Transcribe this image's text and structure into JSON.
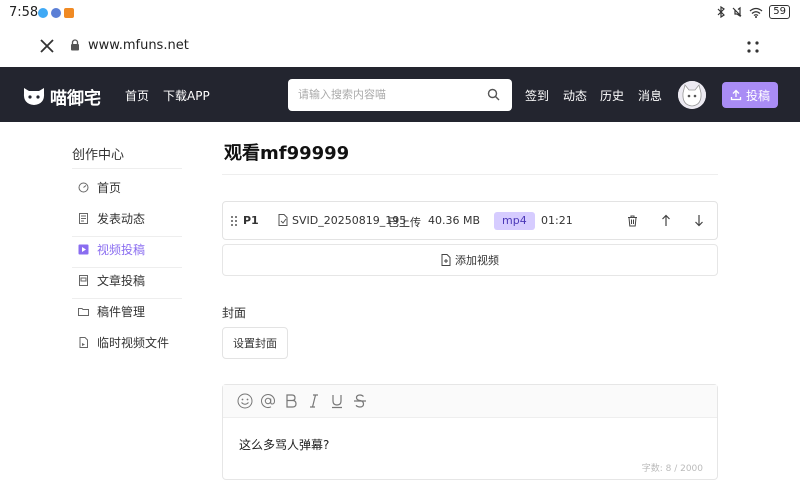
{
  "status_bar": {
    "time": "7:58",
    "battery": "59"
  },
  "browser": {
    "url": "www.mfuns.net"
  },
  "site_nav": {
    "logo_text": "喵御宅",
    "links": [
      {
        "label": "首页"
      },
      {
        "label": "下载APP"
      }
    ],
    "search_placeholder": "请输入搜索内容喵",
    "right_links": [
      {
        "label": "签到"
      },
      {
        "label": "动态"
      },
      {
        "label": "历史"
      },
      {
        "label": "消息"
      }
    ],
    "upload_label": "投稿"
  },
  "sidebar": {
    "title": "创作中心",
    "items": [
      {
        "label": "首页",
        "icon": "dashboard-icon"
      },
      {
        "label": "发表动态",
        "icon": "document-icon"
      },
      {
        "label": "视频投稿",
        "icon": "video-icon",
        "active": true
      },
      {
        "label": "文章投稿",
        "icon": "article-icon"
      },
      {
        "label": "稿件管理",
        "icon": "folder-icon"
      },
      {
        "label": "临时视频文件",
        "icon": "file-icon"
      }
    ]
  },
  "main": {
    "title": "观看mf99999",
    "file": {
      "part": "P1",
      "name": "SVID_20250819_195",
      "status": "已上传",
      "size": "40.36 MB",
      "format": "mp4",
      "duration": "01:21"
    },
    "add_video_label": "添加视频",
    "cover_label": "封面",
    "cover_button": "设置封面",
    "editor": {
      "text": "这么多骂人弹幕?",
      "char_count": "字数: 8 / 2000"
    }
  },
  "colors": {
    "nav_bg": "#23252f",
    "accent": "#a98cf5",
    "active_text": "#8a6df0",
    "tag_bg": "#d6ccff"
  }
}
